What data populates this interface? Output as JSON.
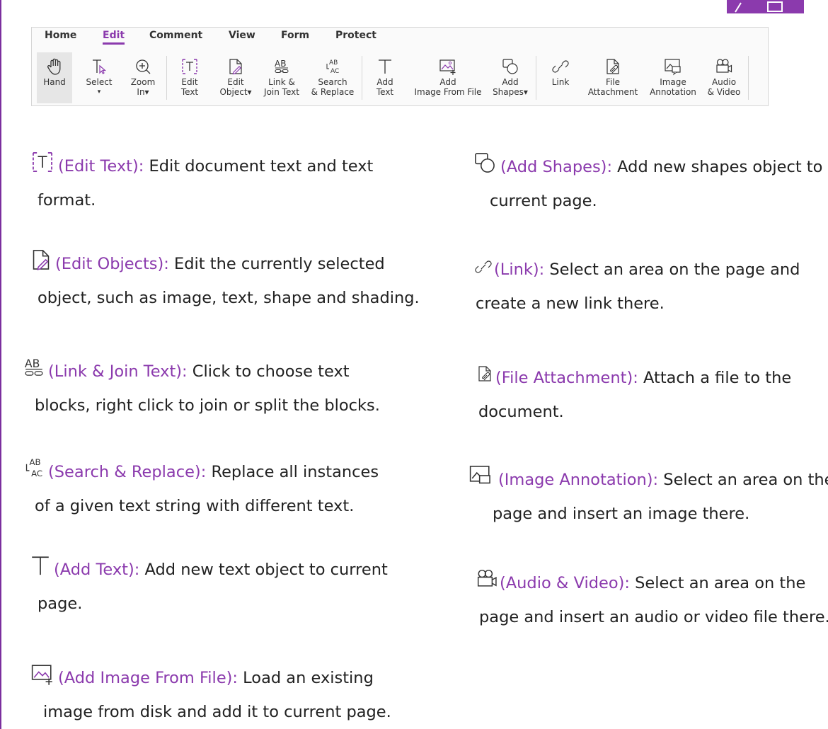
{
  "colors": {
    "accent": "#8b3aad",
    "frame": "#7b2f9e"
  },
  "ribbon": {
    "tabs": [
      {
        "label": "Home"
      },
      {
        "label": "Edit",
        "active": true
      },
      {
        "label": "Comment"
      },
      {
        "label": "View"
      },
      {
        "label": "Form"
      },
      {
        "label": "Protect"
      }
    ],
    "tools": {
      "hand": {
        "l1": "Hand",
        "icon": "hand-icon",
        "selected": true
      },
      "select": {
        "l1": "Select",
        "l2": "▾",
        "icon": "select-text-icon"
      },
      "zoom": {
        "l1": "Zoom",
        "l2": "In▾",
        "icon": "zoom-in-icon"
      },
      "edit_text": {
        "l1": "Edit",
        "l2": "Text",
        "icon": "edit-text-icon"
      },
      "edit_object": {
        "l1": "Edit",
        "l2": "Object▾",
        "icon": "edit-object-icon"
      },
      "link_join": {
        "l1": "Link &",
        "l2": "Join Text",
        "icon": "link-join-text-icon"
      },
      "search_replace": {
        "l1": "Search",
        "l2": "& Replace",
        "icon": "search-replace-icon"
      },
      "add_text": {
        "l1": "Add",
        "l2": "Text",
        "icon": "add-text-icon"
      },
      "add_image": {
        "l1": "Add",
        "l2": "Image From File",
        "icon": "add-image-icon"
      },
      "add_shapes": {
        "l1": "Add",
        "l2": "Shapes▾",
        "icon": "add-shapes-icon"
      },
      "link": {
        "l1": "Link",
        "icon": "link-icon"
      },
      "file_attachment": {
        "l1": "File",
        "l2": "Attachment",
        "icon": "file-attachment-icon"
      },
      "image_annotation": {
        "l1": "Image",
        "l2": "Annotation",
        "icon": "image-annotation-icon"
      },
      "audio_video": {
        "l1": "Audio",
        "l2": "& Video",
        "icon": "audio-video-icon"
      }
    }
  },
  "descriptions": {
    "edit_text": {
      "name": "(Edit Text):",
      "line1": " Edit document text and text",
      "line2": "format."
    },
    "edit_objects": {
      "name": "(Edit Objects):",
      "line1": " Edit the currently selected",
      "line2": "object, such as image, text, shape and shading."
    },
    "link_join": {
      "name": "(Link & Join Text):",
      "line1": " Click to choose text",
      "line2": "blocks, right click to join or split the blocks."
    },
    "search_replace": {
      "name": "(Search & Replace):",
      "line1": " Replace all instances",
      "line2": "of a given text string with different text."
    },
    "add_text": {
      "name": "(Add Text):",
      "line1": " Add new text object to current",
      "line2": "page."
    },
    "add_image": {
      "name": "(Add Image From File):",
      "line1": " Load an existing",
      "line2": "image from disk and add it to current page."
    },
    "add_shapes": {
      "name": "(Add Shapes):",
      "line1": " Add new shapes object to",
      "line2": "current page."
    },
    "link": {
      "name": "(Link):",
      "line1": " Select an area on the page and",
      "line2": "create a new link there."
    },
    "file_attachment": {
      "name": "(File Attachment):",
      "line1": " Attach a file to the",
      "line2": "document."
    },
    "image_annotation": {
      "name": "(Image Annotation):",
      "line1": " Select an area on the",
      "line2": "page and insert an image there."
    },
    "audio_video": {
      "name": "(Audio & Video):",
      "line1": " Select an area on the",
      "line2": "page and insert an audio or video file there."
    }
  }
}
